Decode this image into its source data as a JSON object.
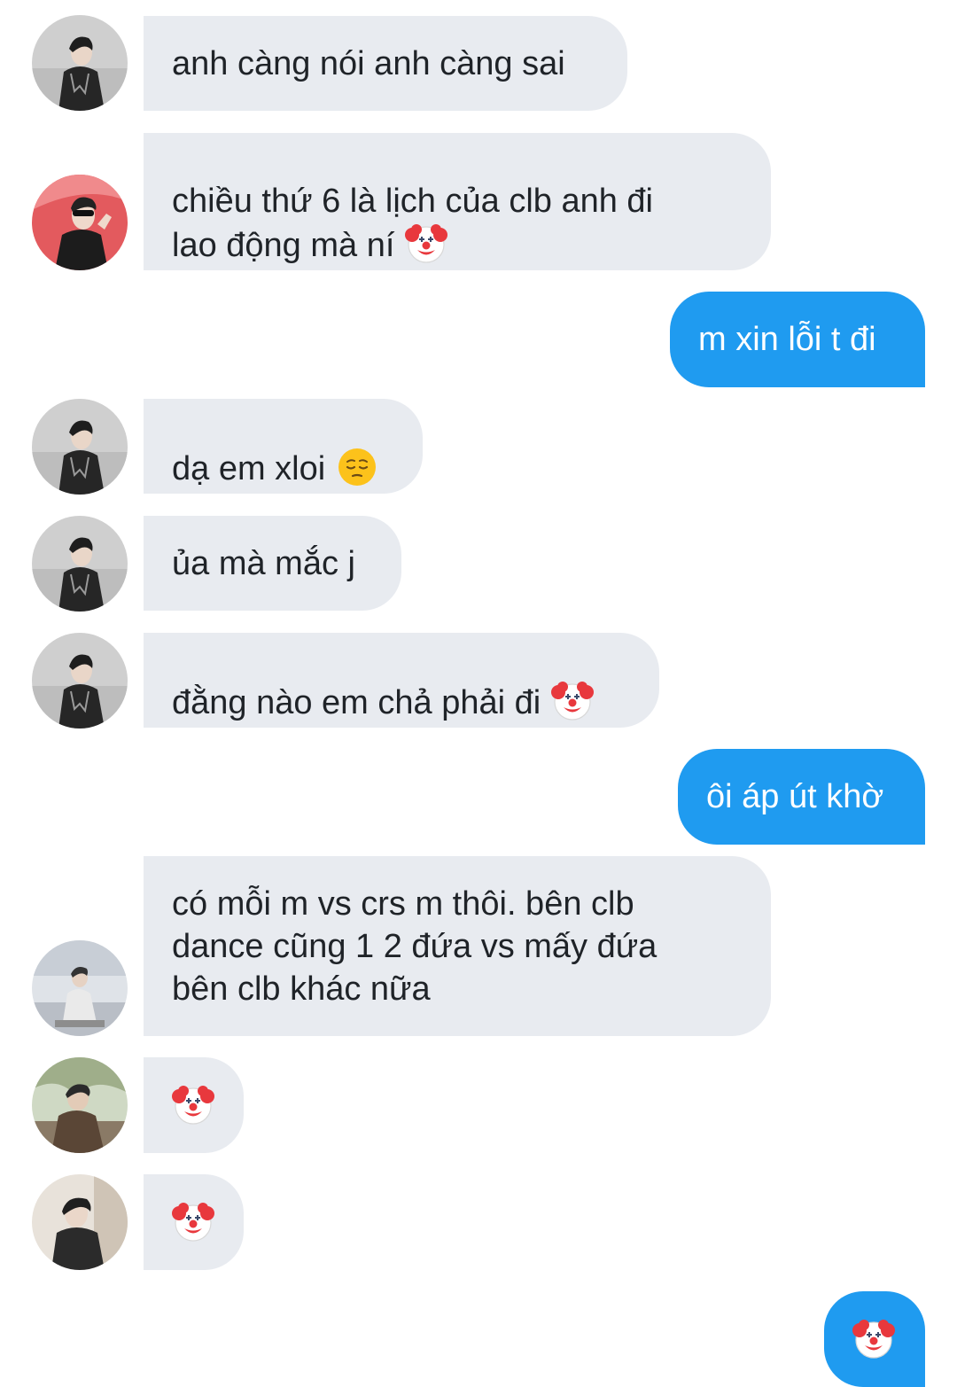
{
  "messages": [
    {
      "side": "in",
      "avatar": "avatar-guy-black-jacket",
      "text": "anh càng nói anh càng sai",
      "emoji": ""
    },
    {
      "side": "in",
      "avatar": "avatar-guy-sunglasses-red-bg",
      "text": "chiều thứ 6 là lịch của clb anh đi\nlao động mà ní",
      "emoji": "clown-face-icon"
    },
    {
      "side": "out",
      "text": "m xin lỗi t đi"
    },
    {
      "side": "in",
      "avatar": "avatar-guy-black-jacket",
      "text": "dạ em xloi",
      "emoji": "pensive-face-icon"
    },
    {
      "side": "in",
      "avatar": "avatar-guy-black-jacket",
      "text": "ủa mà mắc j",
      "emoji": ""
    },
    {
      "side": "in",
      "avatar": "avatar-guy-black-jacket",
      "text": "đằng nào em chả phải đi",
      "emoji": "clown-face-icon"
    },
    {
      "side": "out",
      "text": "ôi áp út khờ"
    },
    {
      "side": "in",
      "avatar": "avatar-guy-sitting-steps",
      "text": "có mỗi m vs crs m thôi. bên clb\ndance cũng 1 2 đứa vs mấy đứa\nbên clb khác nữa",
      "emoji": ""
    },
    {
      "side": "in",
      "avatar": "avatar-guy-outdoor-trees",
      "text": "",
      "emoji": "clown-face-icon"
    },
    {
      "side": "in",
      "avatar": "avatar-guy-dark-jacket",
      "text": "",
      "emoji": "clown-face-icon"
    },
    {
      "side": "out",
      "text": "",
      "emoji": "clown-face-icon"
    }
  ],
  "colors": {
    "incoming_bubble": "#e8ebf0",
    "outgoing_bubble": "#1f9bf0",
    "incoming_text": "#1f2328",
    "outgoing_text": "#ffffff"
  }
}
